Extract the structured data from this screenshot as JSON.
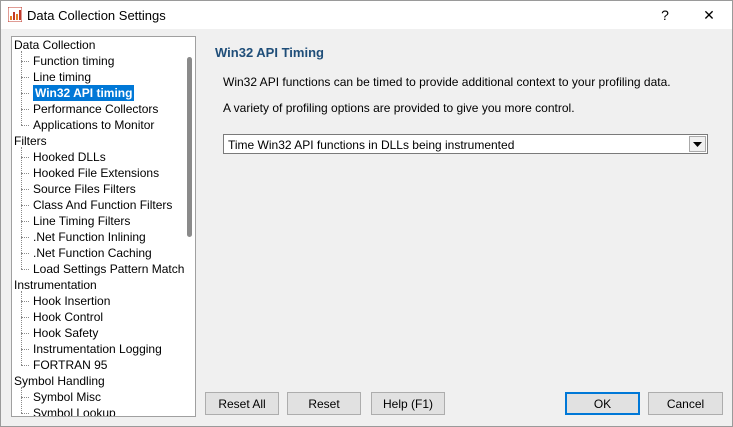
{
  "window": {
    "title": "Data Collection Settings",
    "help_glyph": "?",
    "close_glyph": "✕",
    "icon": "app-icon"
  },
  "tree": {
    "items": [
      {
        "label": "Data Collection",
        "level": 0
      },
      {
        "label": "Function timing",
        "level": 1
      },
      {
        "label": "Line timing",
        "level": 1
      },
      {
        "label": "Win32 API timing",
        "level": 1,
        "selected": true
      },
      {
        "label": "Performance Collectors",
        "level": 1
      },
      {
        "label": "Applications to Monitor",
        "level": 1
      },
      {
        "label": "Filters",
        "level": 0
      },
      {
        "label": "Hooked DLLs",
        "level": 1
      },
      {
        "label": "Hooked File Extensions",
        "level": 1
      },
      {
        "label": "Source Files Filters",
        "level": 1
      },
      {
        "label": "Class And Function Filters",
        "level": 1
      },
      {
        "label": "Line Timing Filters",
        "level": 1
      },
      {
        "label": ".Net Function Inlining",
        "level": 1
      },
      {
        "label": ".Net Function Caching",
        "level": 1
      },
      {
        "label": "Load Settings Pattern Match",
        "level": 1
      },
      {
        "label": "Instrumentation",
        "level": 0
      },
      {
        "label": "Hook Insertion",
        "level": 1
      },
      {
        "label": "Hook Control",
        "level": 1
      },
      {
        "label": "Hook Safety",
        "level": 1
      },
      {
        "label": "Instrumentation Logging",
        "level": 1
      },
      {
        "label": "FORTRAN 95",
        "level": 1
      },
      {
        "label": "Symbol Handling",
        "level": 0
      },
      {
        "label": "Symbol Misc",
        "level": 1
      },
      {
        "label": "Symbol Lookup",
        "level": 1
      }
    ]
  },
  "main": {
    "title": "Win32 API Timing",
    "desc1": "Win32 API functions can be timed to provide additional context to your profiling data.",
    "desc2": "A variety of profiling options are provided to give you more control.",
    "combo_value": "Time Win32 API functions in DLLs being instrumented"
  },
  "buttons": {
    "reset_all": "Reset All",
    "reset": "Reset",
    "help": "Help (F1)",
    "ok": "OK",
    "cancel": "Cancel"
  },
  "colors": {
    "selection": "#0078d7",
    "section_title": "#1f4e79"
  }
}
